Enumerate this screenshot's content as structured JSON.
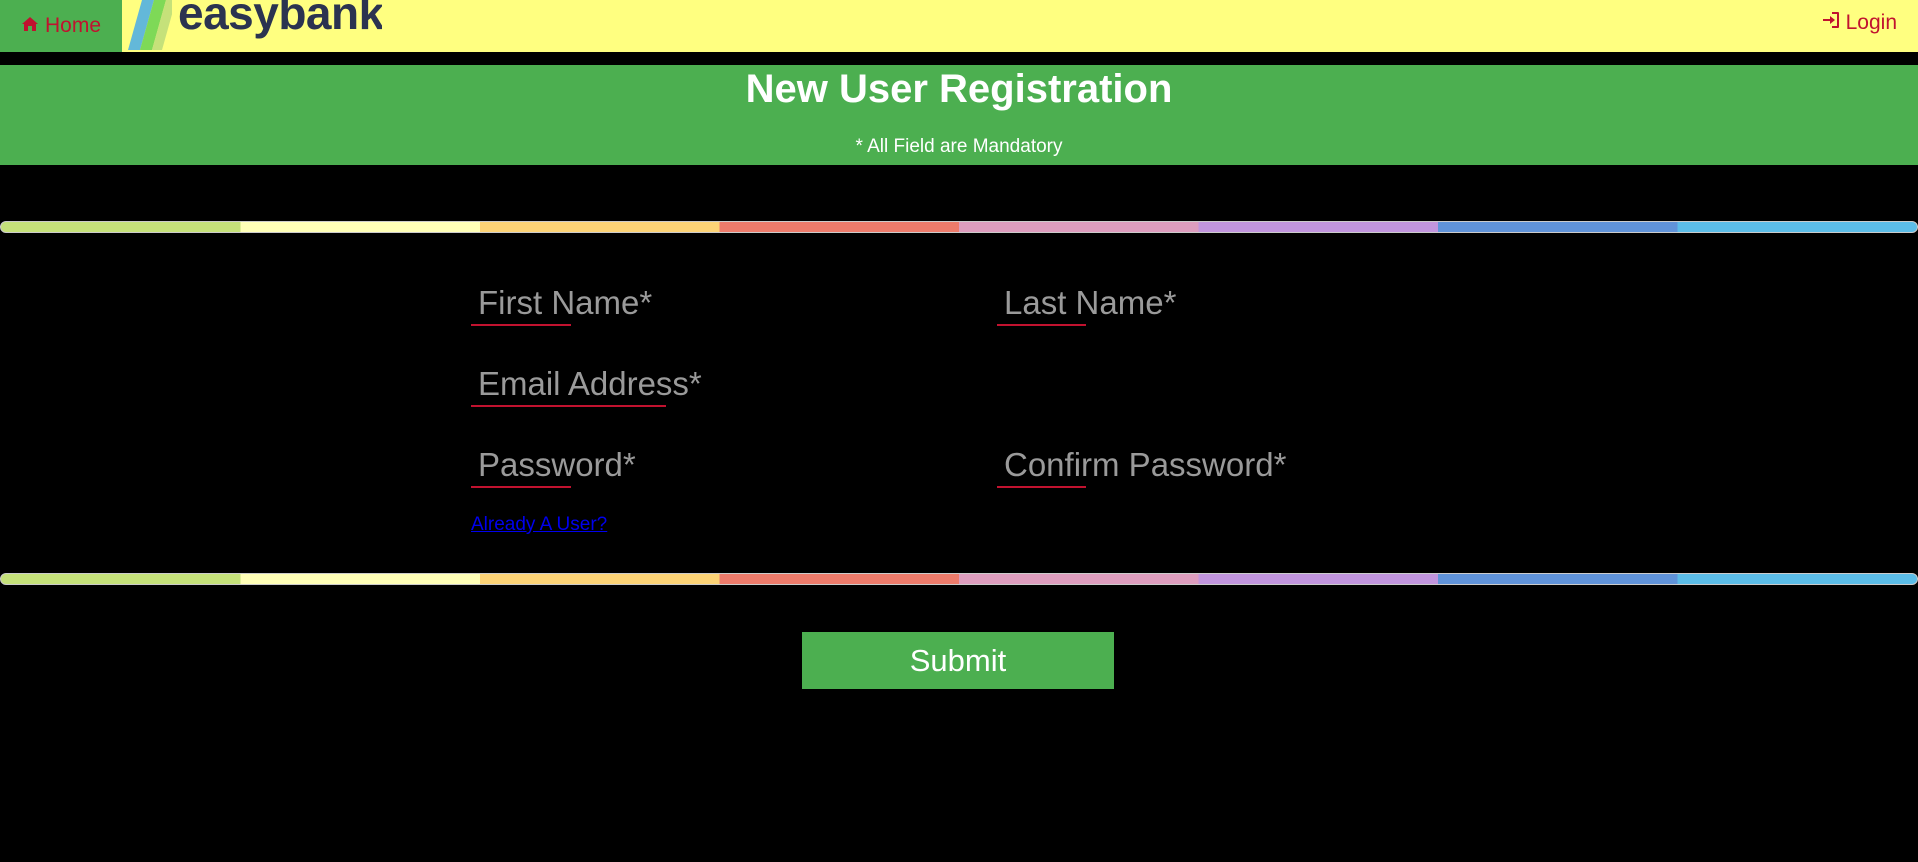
{
  "navbar": {
    "home_label": "Home",
    "home_icon": "home-icon",
    "logo_text": "easybank",
    "login_label": "Login",
    "login_icon": "sign-in-icon"
  },
  "header": {
    "title": "New User Registration",
    "note": "* All Field are Mandatory"
  },
  "form": {
    "first_name_placeholder": "First Name*",
    "last_name_placeholder": "Last Name*",
    "email_placeholder": "Email Address*",
    "password_placeholder": "Password*",
    "confirm_password_placeholder": "Confirm Password*",
    "already_user_link": "Already A User?",
    "submit_label": "Submit"
  },
  "colors": {
    "navbar_bg": "#ffff80",
    "accent_green": "#4caf50",
    "link_red": "#c1122f",
    "link_blue": "#0000ee",
    "page_bg": "#000000",
    "rainbow": [
      "#c5e17a",
      "#ffffb7",
      "#fcd376",
      "#ed7b6b",
      "#dd9dbe",
      "#c195dd",
      "#6093d9",
      "#5cbde8"
    ]
  }
}
